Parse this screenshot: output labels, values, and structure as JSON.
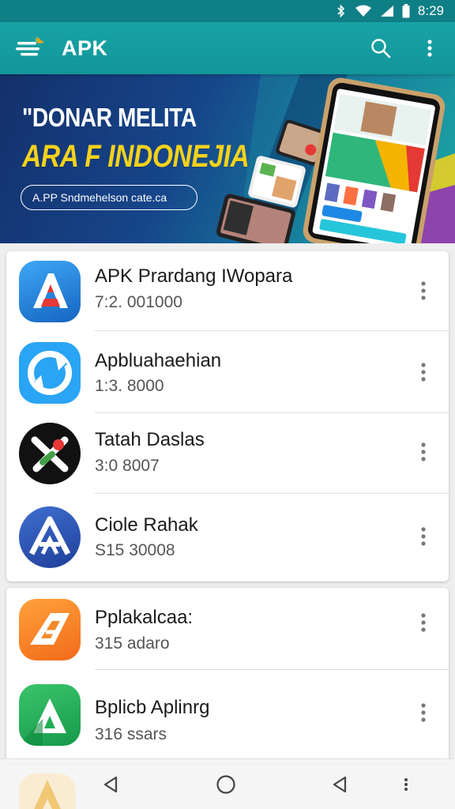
{
  "status_bar": {
    "time": "8:29"
  },
  "app_bar": {
    "title": "APK",
    "icons": [
      "menu-logo-icon",
      "search-icon",
      "more-vert-icon"
    ]
  },
  "banner": {
    "headline": "\"DONAR MELITA",
    "subheadline": "ARA F INDONEJIA",
    "button_label": "A.PP Sndmehelson cate.ca"
  },
  "apps": [
    {
      "name": "APK Prardang IWopara",
      "meta": "7:2. 001000",
      "icon": "a-logo-icon"
    },
    {
      "name": "Apbluahaehian",
      "meta": "1:3. 8000",
      "icon": "refresh-logo-icon"
    },
    {
      "name": "Tatah Daslas",
      "meta": "3:0 8007",
      "icon": "x-logo-icon"
    },
    {
      "name": "Ciole Rahak",
      "meta": "S15 30008",
      "icon": "a-triangle-logo-icon"
    },
    {
      "name": "Pplakalcaa:",
      "meta": "315 adaro",
      "icon": "orange-a-logo-icon"
    },
    {
      "name": "Bplicb Aplinrg",
      "meta": "316 ssars",
      "icon": "green-a-logo-icon"
    }
  ],
  "colors": {
    "primary": "#139a9d",
    "status_bar": "#0f7f86",
    "banner_accent": "#f4d21b"
  }
}
